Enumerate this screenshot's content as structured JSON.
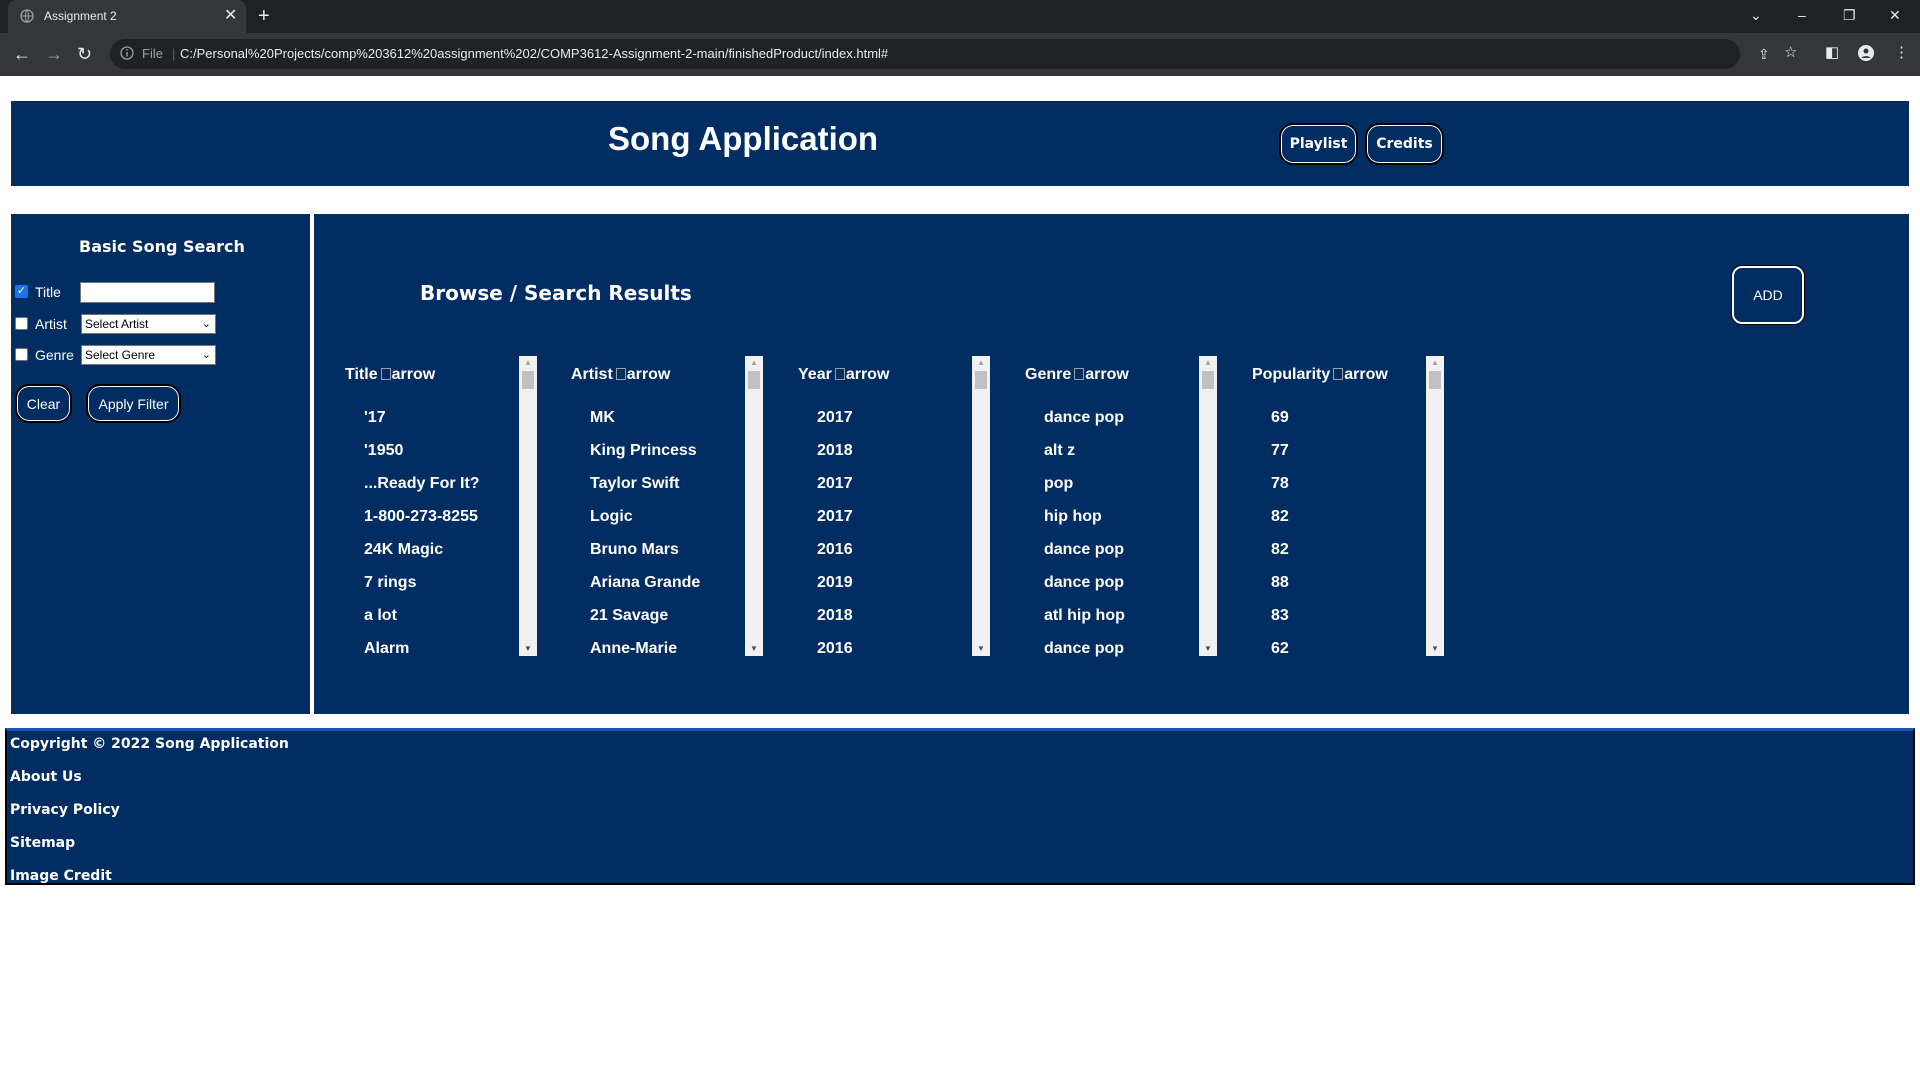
{
  "browser": {
    "tab_title": "Assignment 2",
    "url_prefix": "File",
    "url": "C:/Personal%20Projects/comp%203612%20assignment%202/COMP3612-Assignment-2-main/finishedProduct/index.html#"
  },
  "header": {
    "title": "Song Application",
    "playlist_label": "Playlist",
    "credits_label": "Credits"
  },
  "sidebar": {
    "title": "Basic Song Search",
    "title_label": "Title",
    "title_checked": true,
    "artist_label": "Artist",
    "artist_select": "Select Artist",
    "genre_label": "Genre",
    "genre_select": "Select Genre",
    "clear_label": "Clear",
    "apply_label": "Apply Filter"
  },
  "results": {
    "title": "Browse / Search Results",
    "add_label": "ADD",
    "arrow_alt": "arrow",
    "columns": [
      {
        "header": "Title",
        "items": [
          "'17",
          "'1950",
          "...Ready For It?",
          "1-800-273-8255",
          "24K Magic",
          "7 rings",
          "a lot",
          "Alarm"
        ]
      },
      {
        "header": "Artist",
        "items": [
          "MK",
          "King Princess",
          "Taylor Swift",
          "Logic",
          "Bruno Mars",
          "Ariana Grande",
          "21 Savage",
          "Anne-Marie"
        ]
      },
      {
        "header": "Year",
        "items": [
          "2017",
          "2018",
          "2017",
          "2017",
          "2016",
          "2019",
          "2018",
          "2016"
        ]
      },
      {
        "header": "Genre",
        "items": [
          "dance pop",
          "alt z",
          "pop",
          "hip hop",
          "dance pop",
          "dance pop",
          "atl hip hop",
          "dance pop"
        ]
      },
      {
        "header": "Popularity",
        "items": [
          "69",
          "77",
          "78",
          "82",
          "82",
          "88",
          "83",
          "62"
        ]
      }
    ]
  },
  "footer": {
    "copyright": "Copyright © 2022 Song Application",
    "about": "About Us",
    "privacy": "Privacy Policy",
    "sitemap": "Sitemap",
    "image_credit": "Image Credit"
  },
  "colors": {
    "navy": "#012d63",
    "chrome_dark": "#202124",
    "chrome_mid": "#35363a"
  }
}
